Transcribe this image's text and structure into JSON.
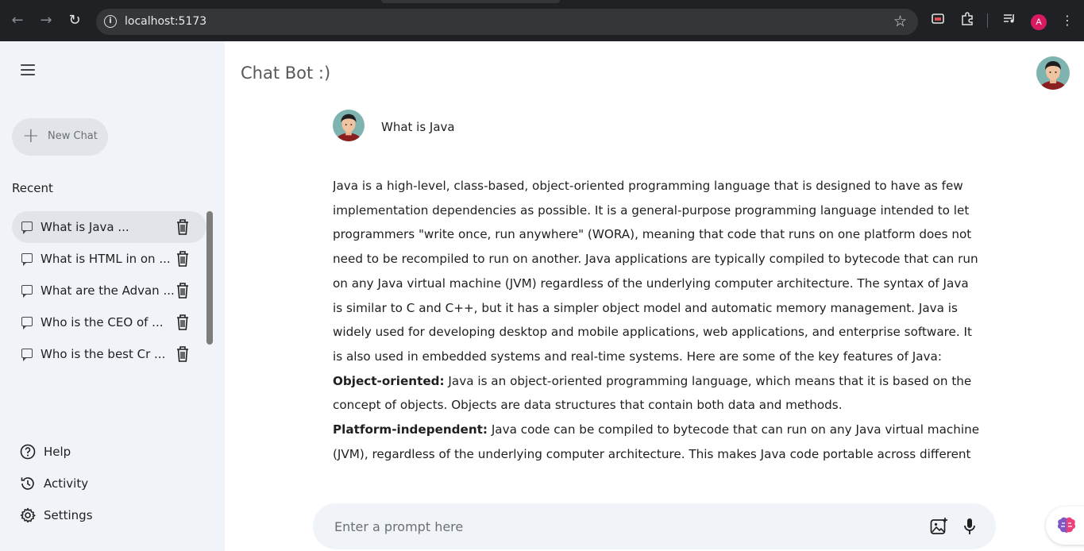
{
  "browser": {
    "url": "localhost:5173",
    "profile_initial": "A",
    "icons": [
      "back-icon",
      "forward-icon",
      "reload-icon",
      "site-info-icon",
      "bookmark-star-icon",
      "cast-icon",
      "extensions-icon",
      "media-control-icon",
      "more-menu-icon"
    ]
  },
  "sidebar": {
    "new_chat_label": "New Chat",
    "recent_title": "Recent",
    "recent_items": [
      {
        "label": "What is Java ..."
      },
      {
        "label": "What is HTML in on ..."
      },
      {
        "label": "What are the Advan ..."
      },
      {
        "label": "Who is the CEO of ..."
      },
      {
        "label": "Who is the best Cr ..."
      }
    ],
    "bottom_items": [
      {
        "label": "Help",
        "icon": "help-icon"
      },
      {
        "label": "Activity",
        "icon": "history-icon"
      },
      {
        "label": "Settings",
        "icon": "gear-icon"
      }
    ]
  },
  "main": {
    "app_title": "Chat Bot :)",
    "question": "What is Java",
    "answer": {
      "intro": "Java is a high-level, class-based, object-oriented programming language that is designed to have as few implementation dependencies as possible. It is a general-purpose programming language intended to let programmers \"write once, run anywhere\" (WORA), meaning that code that runs on one platform does not need to be recompiled to run on another. Java applications are typically compiled to bytecode that can run on any Java virtual machine (JVM) regardless of the underlying computer architecture. The syntax of Java is similar to C and C++, but it has a simpler object model and automatic memory management. Java is widely used for developing desktop and mobile applications, web applications, and enterprise software. It is also used in embedded systems and real-time systems. Here are some of the key features of Java:",
      "feature1_title": "Object-oriented:",
      "feature1_text": " Java is an object-oriented programming language, which means that it is based on the concept of objects. Objects are data structures that contain both data and methods.",
      "feature2_title": "Platform-independent:",
      "feature2_text": " Java code can be compiled to bytecode that can run on any Java virtual machine (JVM), regardless of the underlying computer architecture. This makes Java code portable across different"
    },
    "prompt_placeholder": "Enter a prompt here"
  },
  "colors": {
    "sidebar_bg": "#f0f4f9",
    "active_item_bg": "#e1e5ea",
    "chrome_bg": "#202124",
    "profile_badge": "#d81b60"
  }
}
